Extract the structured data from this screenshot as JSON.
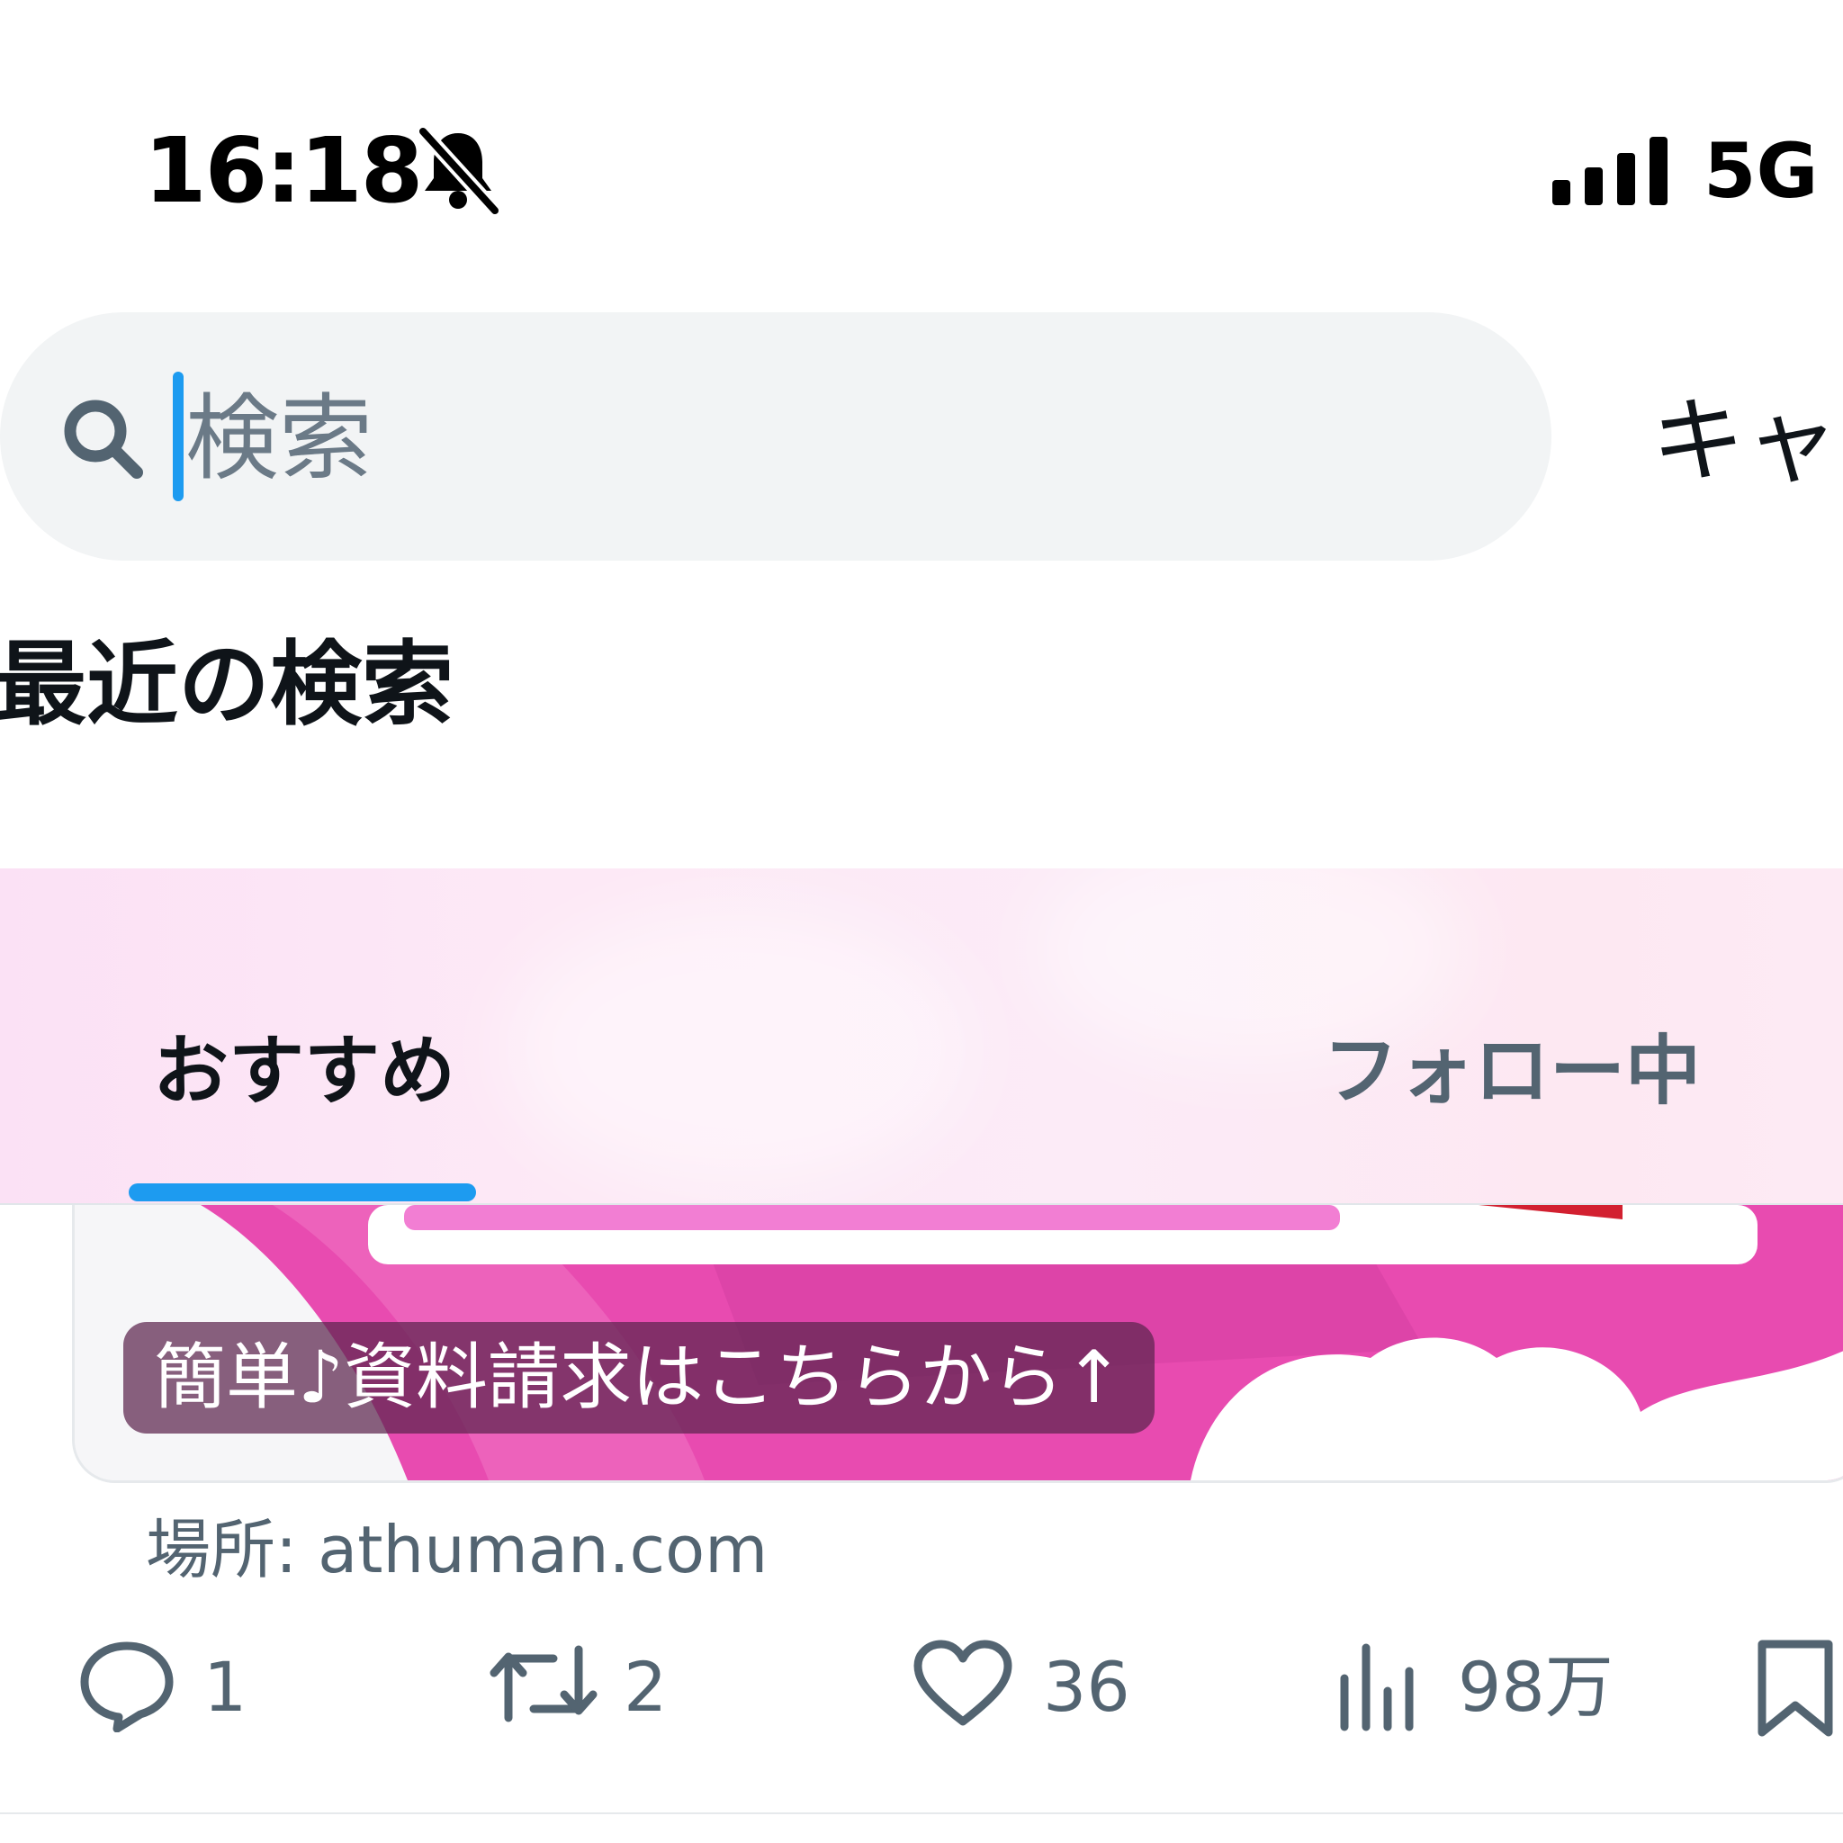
{
  "status_bar": {
    "time": "16:18",
    "network": "5G",
    "mute_icon": "bell-slash-icon",
    "signal_icon": "signal-bars-icon"
  },
  "search": {
    "placeholder": "検索",
    "cancel_label": "キャ",
    "icon": "search-icon"
  },
  "recent_searches": {
    "title": "最近の検索"
  },
  "tabs": [
    {
      "label": "おすすめ",
      "active": true
    },
    {
      "label": "フォロー中",
      "active": false
    }
  ],
  "ad": {
    "caption": "簡単♪資料請求はこちらから↑",
    "location": "場所: athuman.com"
  },
  "actions": {
    "replies": "1",
    "retweets": "2",
    "likes": "36",
    "views": "98万"
  },
  "colors": {
    "accent": "#1d9bf0",
    "secondary_text": "#536471",
    "primary_text": "#0f1419",
    "search_bg": "#f2f4f5",
    "ad_pink": "#e84bb0"
  }
}
